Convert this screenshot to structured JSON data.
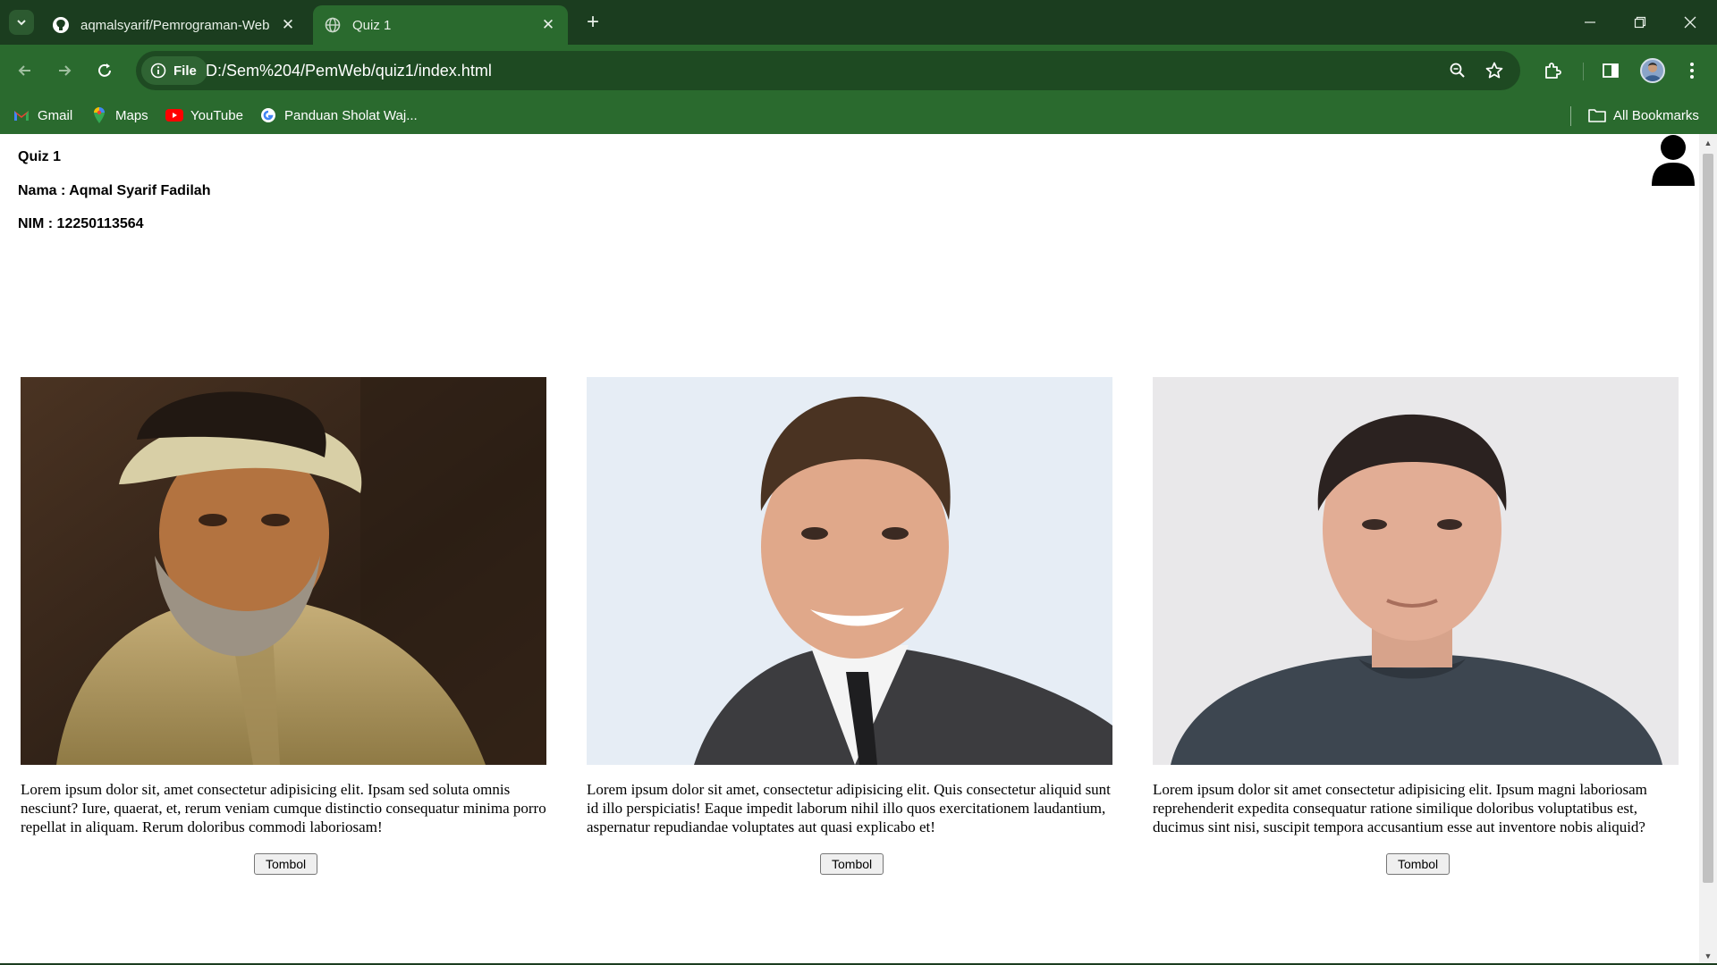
{
  "browser": {
    "tabs": [
      {
        "title": "aqmalsyarif/Pemrograman-Web",
        "icon": "github-icon",
        "active": false
      },
      {
        "title": "Quiz 1",
        "icon": "globe-icon",
        "active": true
      }
    ],
    "chip_label": "File",
    "url": "D:/Sem%204/PemWeb/quiz1/index.html",
    "bookmarks": [
      {
        "label": "Gmail",
        "icon": "gmail-icon"
      },
      {
        "label": "Maps",
        "icon": "maps-icon"
      },
      {
        "label": "YouTube",
        "icon": "youtube-icon"
      },
      {
        "label": "Panduan Sholat Waj...",
        "icon": "google-icon"
      }
    ],
    "all_bookmarks_label": "All Bookmarks",
    "colors": {
      "frame": "#1b3d1f",
      "toolbar": "#2a6a2e"
    }
  },
  "page": {
    "heading": "Quiz 1",
    "nama": "Nama : Aqmal Syarif Fadilah",
    "nim": "NIM : 12250113564",
    "cards": [
      {
        "image": "portrait-painting-man-turban",
        "text": "Lorem ipsum dolor sit, amet consectetur adipisicing elit. Ipsam sed soluta omnis nesciunt? Iure, quaerat, et, rerum veniam cumque distinctio consequatur minima porro repellat in aliquam. Rerum doloribus commodi laboriosam!",
        "button": "Tombol"
      },
      {
        "image": "photo-man-suit-smiling",
        "text": "Lorem ipsum dolor sit amet, consectetur adipisicing elit. Quis consectetur aliquid sunt id illo perspiciatis! Eaque impedit laborum nihil illo quos exercitationem laudantium, aspernatur repudiandae voluptates aut quasi explicabo et!",
        "button": "Tombol"
      },
      {
        "image": "photo-man-gray-tshirt",
        "text": "Lorem ipsum dolor sit amet consectetur adipisicing elit. Ipsum magni laboriosam reprehenderit expedita consequatur ratione similique doloribus voluptatibus est, ducimus sint nisi, suscipit tempora accusantium esse aut inventore nobis aliquid?",
        "button": "Tombol"
      }
    ]
  }
}
